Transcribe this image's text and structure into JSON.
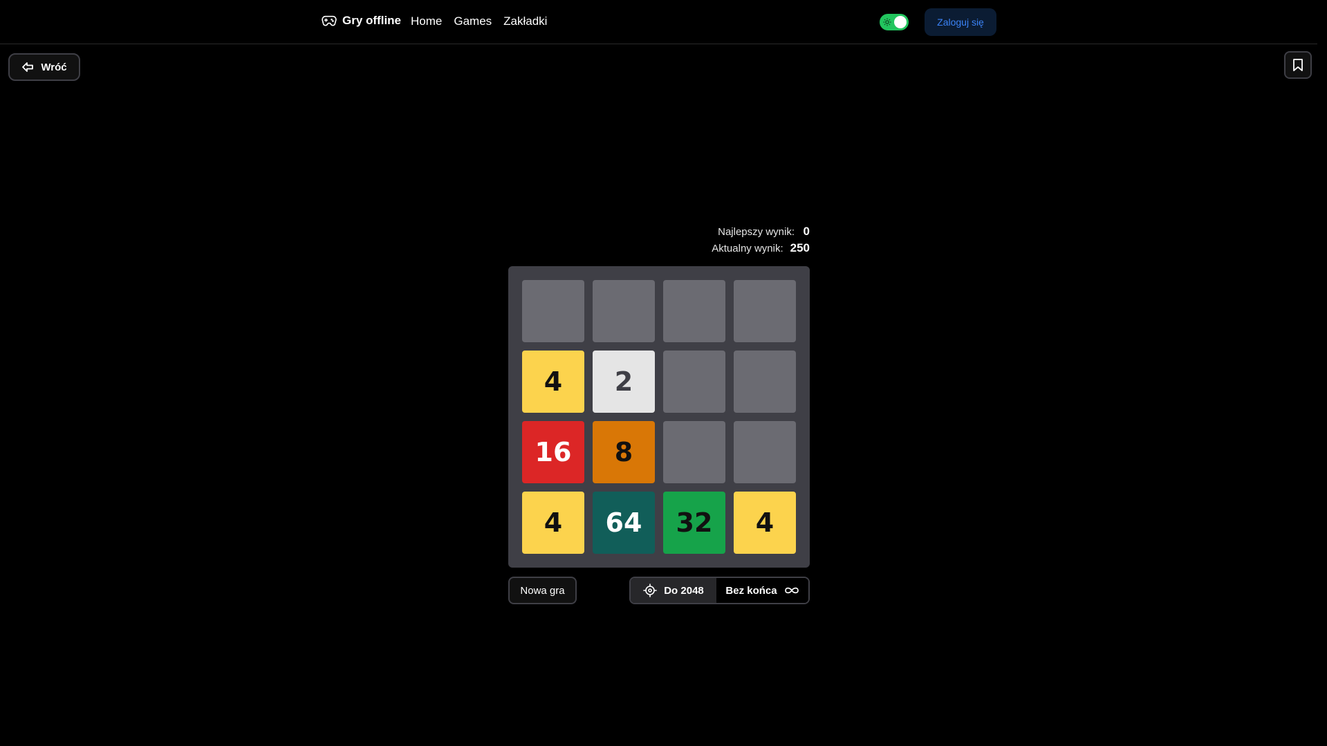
{
  "header": {
    "brand": "Gry offline",
    "nav": [
      "Home",
      "Games",
      "Zakładki"
    ],
    "theme_toggle_on": true,
    "login_label": "Zaloguj się"
  },
  "back": {
    "label": "Wróć"
  },
  "scores": {
    "best_label": "Najlepszy wynik:",
    "best_value": "0",
    "current_label": "Aktualny wynik:",
    "current_value": "250"
  },
  "board": {
    "cells": [
      null,
      null,
      null,
      null,
      "4",
      "2",
      null,
      null,
      "16",
      "8",
      null,
      null,
      "4",
      "64",
      "32",
      "4"
    ]
  },
  "controls": {
    "new_game": "Nowa gra",
    "mode_target": "Do 2048",
    "mode_endless": "Bez końca"
  },
  "colors": {
    "empty": "#6b6b72",
    "2": "#e5e5e5",
    "4": "#fcd34d",
    "8": "#d97706",
    "16": "#dc2626",
    "32": "#16a34a",
    "64": "#115e59",
    "accent_toggle": "#22c55e",
    "login_text": "#3b82f6"
  }
}
